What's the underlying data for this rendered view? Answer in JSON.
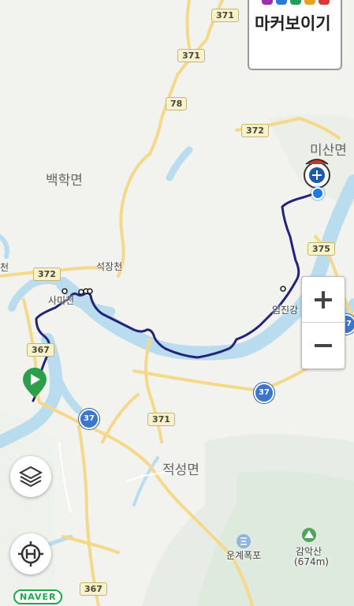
{
  "map": {
    "places": [
      {
        "name": "백학면",
        "size": "big"
      },
      {
        "name": "미산면",
        "size": "big"
      },
      {
        "name": "적성면",
        "size": "big"
      },
      {
        "name": "석장천",
        "size": "small"
      },
      {
        "name": "사미천",
        "size": "small"
      },
      {
        "name": "임진강",
        "size": "small"
      },
      {
        "name": "천",
        "size": "small"
      },
      {
        "name": "운계폭포",
        "size": "small"
      },
      {
        "name": "감악산",
        "size": "small"
      },
      {
        "name": "(674m)",
        "size": "small"
      }
    ],
    "route_shields": [
      "371",
      "371",
      "78",
      "372",
      "372",
      "367",
      "375",
      "371",
      "367"
    ],
    "expressway_roundels": [
      "37",
      "37",
      "37"
    ],
    "route_color": "#23237a",
    "river_color": "#b9dcef"
  },
  "marker_panel": {
    "label": "마커보이기",
    "pin_colors": [
      "#9b2fb0",
      "#2a7ad8",
      "#1f9e58",
      "#e6a41e",
      "#d83a3a"
    ]
  },
  "controls": {
    "zoom_in": "+",
    "zoom_out": "−",
    "layers_icon": "layers-icon",
    "helipad_icon": "helipad-locate-icon"
  },
  "attribution": "NAVER",
  "colors": {
    "start_marker": "#2f9e4c",
    "current_location": "#1e78e6"
  }
}
